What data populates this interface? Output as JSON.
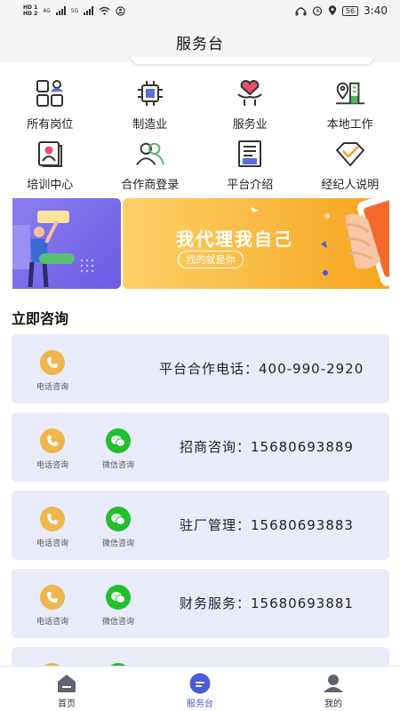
{
  "status_bar": {
    "hd_top": "HD 1",
    "hd_bottom": "HD 2",
    "net1": "4G",
    "net2": "5G",
    "battery": "56",
    "time": "3:40"
  },
  "header": {
    "title": "服务台"
  },
  "categories": [
    {
      "label": "所有岗位",
      "icon": "grid-person-icon"
    },
    {
      "label": "制造业",
      "icon": "chip-icon"
    },
    {
      "label": "服务业",
      "icon": "heart-hand-icon"
    },
    {
      "label": "本地工作",
      "icon": "location-building-icon"
    },
    {
      "label": "培训中心",
      "icon": "training-board-icon"
    },
    {
      "label": "合作商登录",
      "icon": "partners-icon"
    },
    {
      "label": "平台介绍",
      "icon": "document-icon"
    },
    {
      "label": "经纪人说明",
      "icon": "diamond-check-icon"
    }
  ],
  "banner": {
    "headline": "我代理我自己",
    "pill": "找的就是你"
  },
  "consult": {
    "title": "立即咨询",
    "phone_label": "电话咨询",
    "wechat_label": "微信咨询",
    "cards": [
      {
        "text": "平台合作电话：400-990-2920",
        "wechat": false
      },
      {
        "text": "招商咨询：15680693889",
        "wechat": true
      },
      {
        "text": "驻厂管理：15680693883",
        "wechat": true
      },
      {
        "text": "财务服务：15680693881",
        "wechat": true
      }
    ]
  },
  "bottom_nav": [
    {
      "label": "首页",
      "icon": "home-icon",
      "active": false
    },
    {
      "label": "服务台",
      "icon": "service-desk-icon",
      "active": true
    },
    {
      "label": "我的",
      "icon": "profile-icon",
      "active": false
    }
  ],
  "colors": {
    "accent": "#4a5bd6",
    "card_bg": "#e9ebfb",
    "phone": "#efb64a",
    "wechat": "#1ec12a",
    "banner_orange": "#f9b234",
    "banner_purple": "#7a6ae8"
  }
}
